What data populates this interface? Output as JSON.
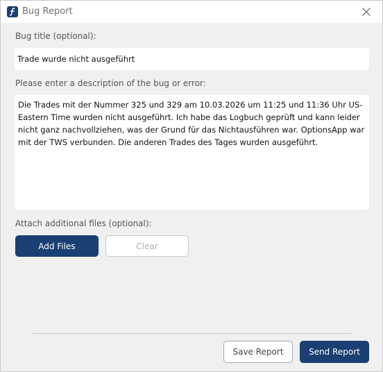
{
  "window": {
    "title": "Bug Report",
    "icon": "app-logo-icon",
    "close_icon": "close-icon"
  },
  "form": {
    "title_label": "Bug title (optional):",
    "title_value": "Trade wurde nicht ausgeführt",
    "description_label": "Please enter a description of the bug or error:",
    "description_value": "Die Trades mit der Nummer 325 und 329 am 10.03.2026 um 11:25 und 11:36 Uhr US-Eastern Time wurden nicht ausgeführt. Ich habe das Logbuch geprüft und kann leider nicht ganz nachvollziehen, was der Grund für das Nichtausführen war. OptionsApp war mit der TWS verbunden. Die anderen Trades des Tages wurden ausgeführt.",
    "attach_label": "Attach additional files (optional):",
    "add_files_label": "Add Files",
    "clear_label": "Clear"
  },
  "footer": {
    "save_label": "Save Report",
    "send_label": "Send Report"
  },
  "colors": {
    "accent": "#1a3f73",
    "background": "#f0f0f0",
    "field": "#ffffff"
  }
}
